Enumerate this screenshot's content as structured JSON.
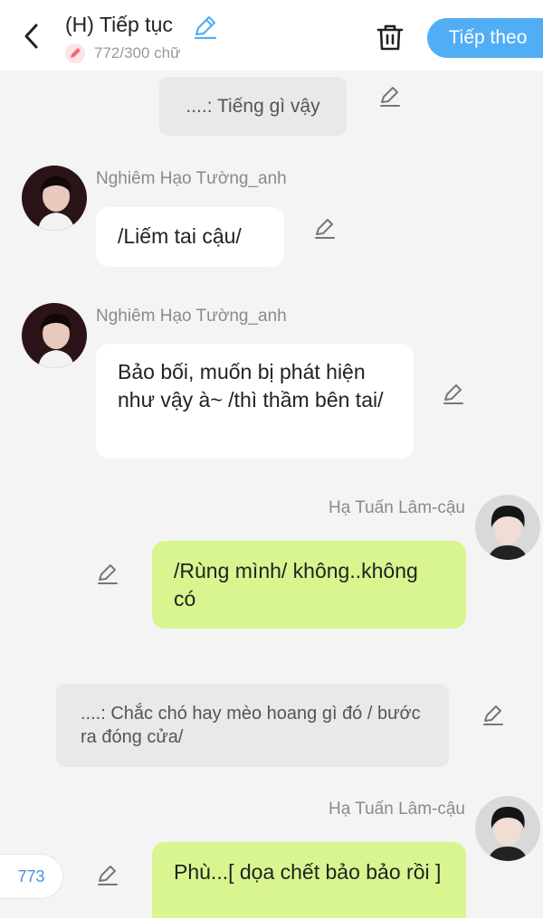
{
  "header": {
    "title": "(H) Tiếp tục",
    "word_count": "772/300 chữ",
    "next_label": "Tiếp theo",
    "accent_color": "#51aef5"
  },
  "messages": [
    {
      "type": "narration",
      "text": "....: Tiếng gì vậy"
    },
    {
      "type": "left",
      "sender": "Nghiêm Hạo Tường_anh",
      "text": "/Liếm tai cậu/"
    },
    {
      "type": "left",
      "sender": "Nghiêm Hạo Tường_anh",
      "text": "Bảo bối, muốn bị phát hiện như vậy à~ /thì thầm bên tai/"
    },
    {
      "type": "right",
      "sender": "Hạ Tuấn Lâm-cậu",
      "text": "/Rùng mình/ không..không có"
    },
    {
      "type": "narration",
      "text": "....: Chắc chó hay mèo hoang gì đó / bước ra đóng cửa/"
    },
    {
      "type": "right",
      "sender": "Hạ Tuấn Lâm-cậu",
      "text": "Phù...[ dọa chết bảo bảo rồi ]"
    }
  ],
  "message_count": "773"
}
